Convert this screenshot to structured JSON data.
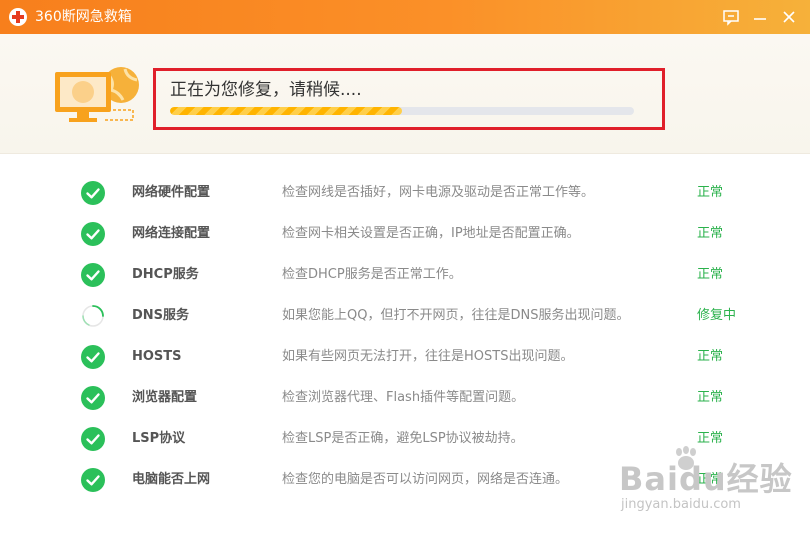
{
  "window": {
    "title": "360断网急救箱",
    "buttons": {
      "feedback": "feedback-icon",
      "minimize": "minimize-icon",
      "close": "close-icon"
    }
  },
  "colors": {
    "title_bar": "#f7891f",
    "accent_ok": "#2bb24c",
    "highlight_border": "#e01f2a",
    "progress": "#ffb400"
  },
  "repair": {
    "message": "正在为您修复，请稍候....",
    "progress_fraction": 0.5
  },
  "checks": [
    {
      "name": "网络硬件配置",
      "description": "检查网线是否插好，网卡电源及驱动是否正常工作等。",
      "status": "正常",
      "state": "ok"
    },
    {
      "name": "网络连接配置",
      "description": "检查网卡相关设置是否正确，IP地址是否配置正确。",
      "status": "正常",
      "state": "ok"
    },
    {
      "name": "DHCP服务",
      "description": "检查DHCP服务是否正常工作。",
      "status": "正常",
      "state": "ok"
    },
    {
      "name": "DNS服务",
      "description": "如果您能上QQ，但打不开网页，往往是DNS服务出现问题。",
      "status": "修复中",
      "state": "repairing"
    },
    {
      "name": "HOSTS",
      "description": "如果有些网页无法打开，往往是HOSTS出现问题。",
      "status": "正常",
      "state": "ok"
    },
    {
      "name": "浏览器配置",
      "description": "检查浏览器代理、Flash插件等配置问题。",
      "status": "正常",
      "state": "ok"
    },
    {
      "name": "LSP协议",
      "description": "检查LSP是否正确，避免LSP协议被劫持。",
      "status": "正常",
      "state": "ok"
    },
    {
      "name": "电脑能否上网",
      "description": "检查您的电脑是否可以访问网页，网络是否连通。",
      "status": "正常",
      "state": "ok"
    }
  ],
  "watermark": {
    "main": "Baidu经验",
    "sub": "jingyan.baidu.com"
  }
}
